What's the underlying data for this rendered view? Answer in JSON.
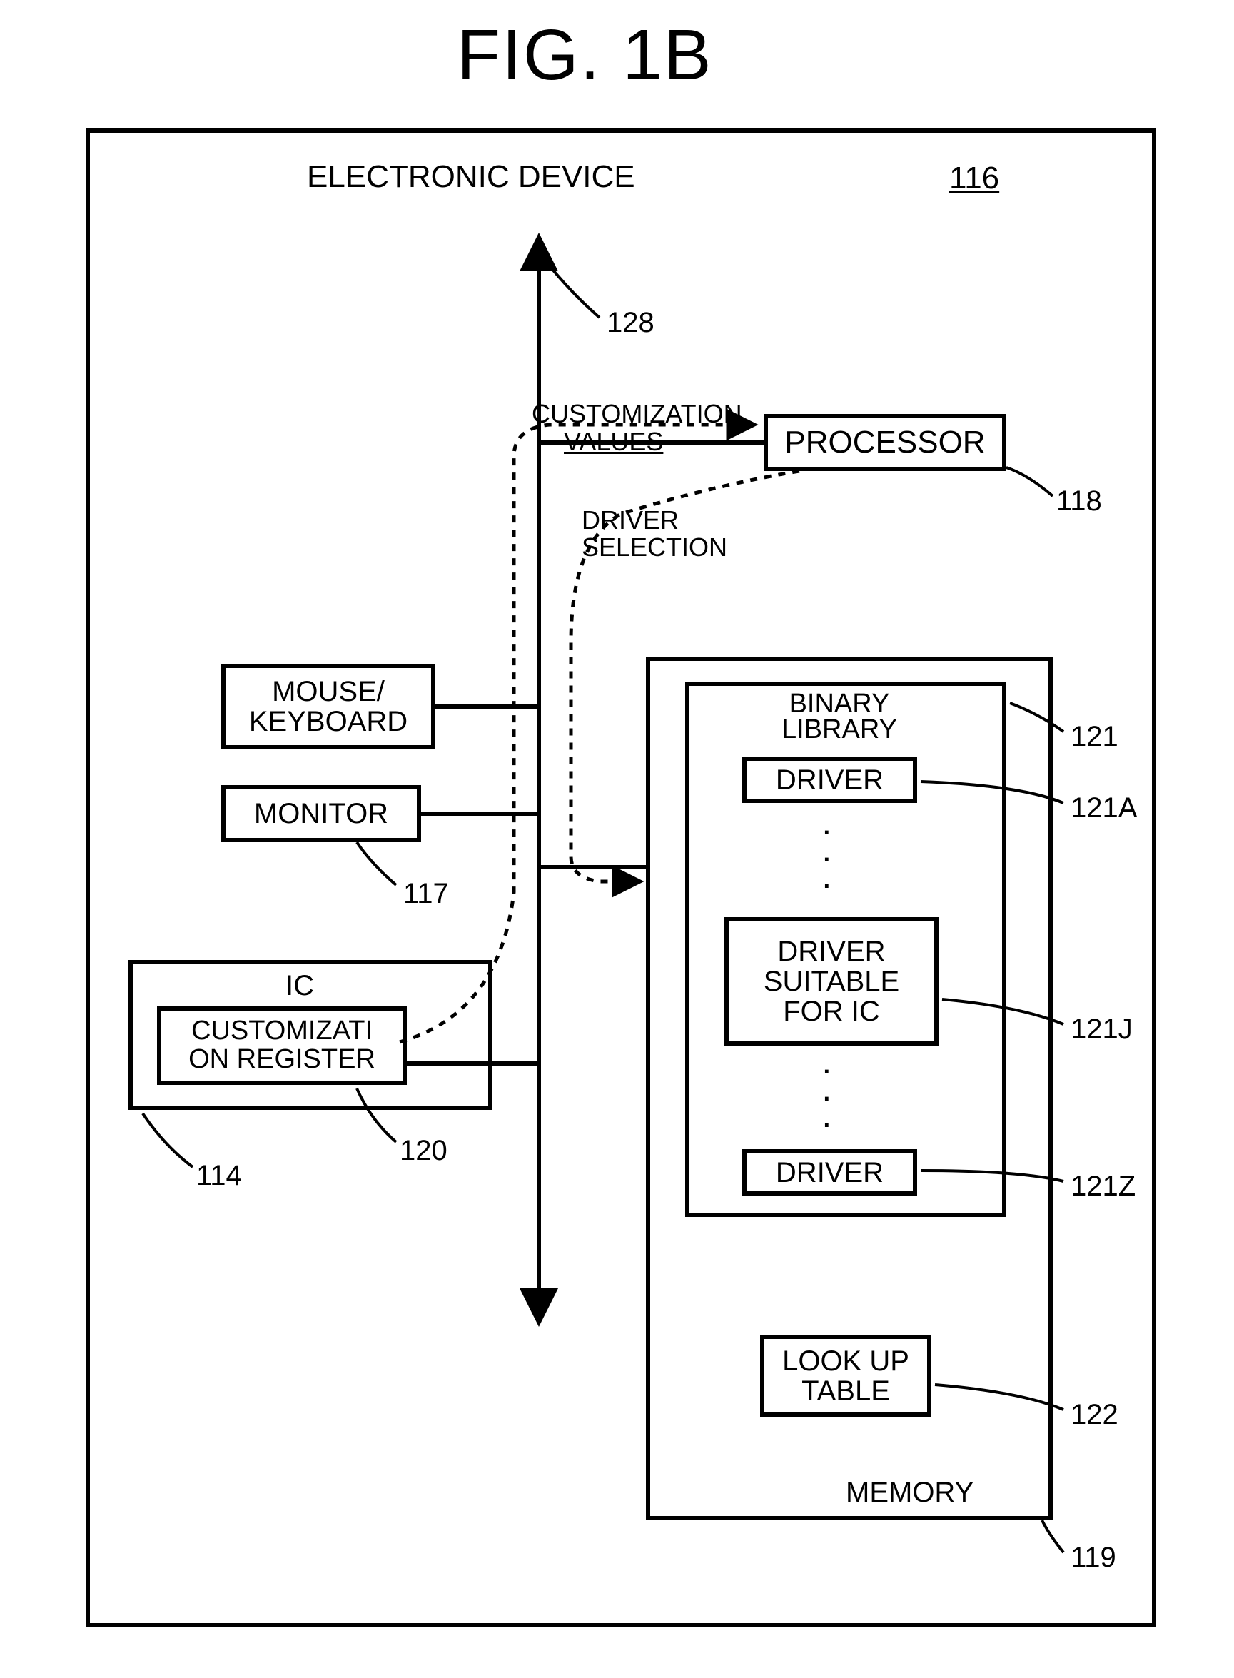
{
  "figure_title": "FIG. 1B",
  "labels": {
    "electronic_device": "ELECTRONIC DEVICE",
    "customization_values": "CUSTOMIZATION",
    "customization_values2": "VALUES",
    "driver_selection": "DRIVER\nSELECTION",
    "processor": "PROCESSOR",
    "mouse_keyboard": "MOUSE/\nKEYBOARD",
    "monitor": "MONITOR",
    "ic": "IC",
    "customization_register": "CUSTOMIZATI\nON REGISTER",
    "binary_library": "BINARY\nLIBRARY",
    "driver": "DRIVER",
    "driver_suitable": "DRIVER\nSUITABLE\nFOR IC",
    "lookup": "LOOK UP\nTABLE",
    "memory": "MEMORY"
  },
  "refs": {
    "r116": "116",
    "r128": "128",
    "r118": "118",
    "r117": "117",
    "r120": "120",
    "r114": "114",
    "r121": "121",
    "r121A": "121A",
    "r121J": "121J",
    "r121Z": "121Z",
    "r122": "122",
    "r119": "119"
  }
}
